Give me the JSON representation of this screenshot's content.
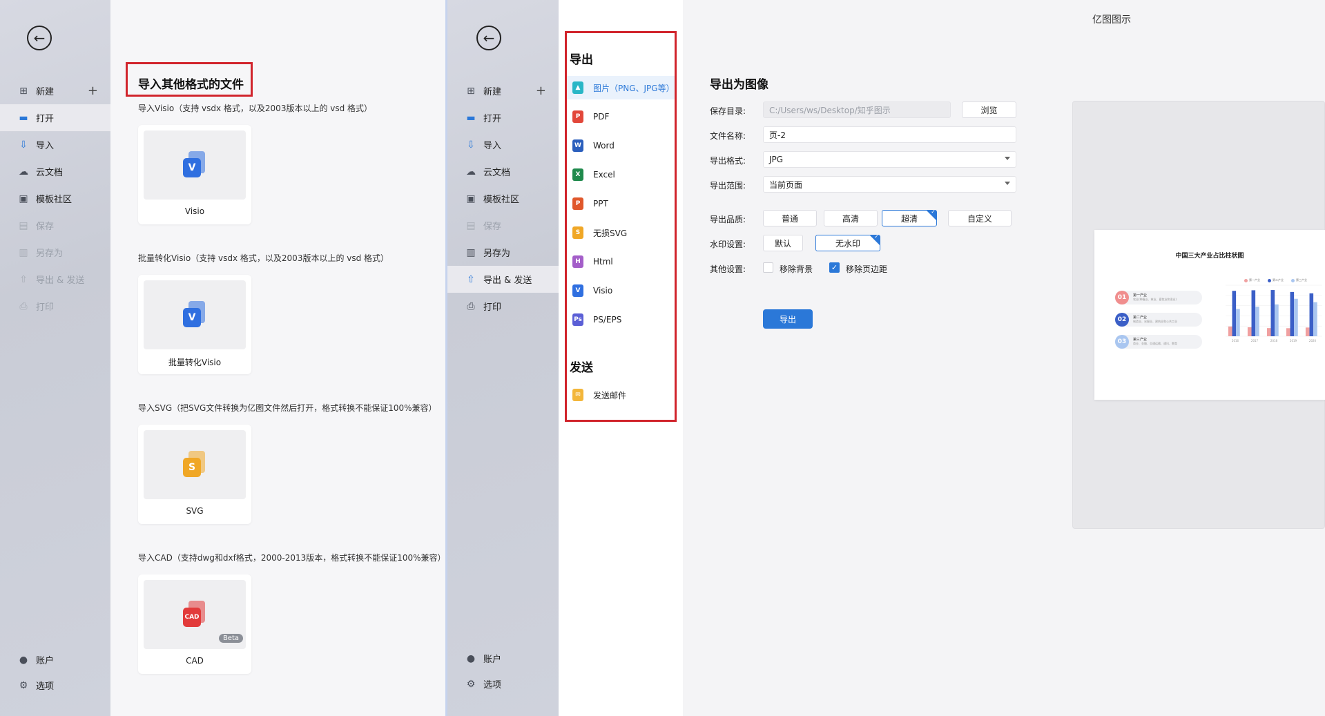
{
  "app_title": "亿图图示",
  "left_nav": {
    "items": [
      {
        "label": "新建",
        "icon": "plus-square-icon",
        "state": "normal"
      },
      {
        "label": "打开",
        "icon": "folder-icon",
        "state": "active"
      },
      {
        "label": "导入",
        "icon": "import-icon",
        "state": "normal"
      },
      {
        "label": "云文档",
        "icon": "cloud-icon",
        "state": "normal"
      },
      {
        "label": "模板社区",
        "icon": "community-icon",
        "state": "normal"
      },
      {
        "label": "保存",
        "icon": "save-icon",
        "state": "disabled"
      },
      {
        "label": "另存为",
        "icon": "save-as-icon",
        "state": "disabled"
      },
      {
        "label": "导出 & 发送",
        "icon": "export-icon",
        "state": "disabled"
      },
      {
        "label": "打印",
        "icon": "print-icon",
        "state": "disabled"
      }
    ],
    "bottom": [
      {
        "label": "账户",
        "icon": "account-icon"
      },
      {
        "label": "选项",
        "icon": "gear-icon"
      }
    ]
  },
  "import_panel": {
    "title": "导入其他格式的文件",
    "sections": [
      {
        "desc": "导入Visio（支持 vsdx 格式，以及2003版本以上的 vsd 格式）",
        "card_label": "Visio",
        "icon_letter": "V",
        "color": "#2f6fe0"
      },
      {
        "desc": "批量转化Visio（支持 vsdx 格式，以及2003版本以上的 vsd 格式）",
        "card_label": "批量转化Visio",
        "icon_letter": "V",
        "color": "#2f6fe0"
      },
      {
        "desc": "导入SVG（把SVG文件转换为亿图文件然后打开，格式转换不能保证100%兼容）",
        "card_label": "SVG",
        "icon_letter": "S",
        "color": "#f0a726"
      },
      {
        "desc": "导入CAD（支持dwg和dxf格式，2000-2013版本，格式转换不能保证100%兼容）",
        "card_label": "CAD",
        "icon_letter": "CAD",
        "color": "#e23b3b",
        "badge": "Beta"
      }
    ]
  },
  "right_nav": {
    "items": [
      {
        "label": "新建",
        "icon": "plus-square-icon",
        "state": "normal"
      },
      {
        "label": "打开",
        "icon": "folder-icon",
        "state": "normal"
      },
      {
        "label": "导入",
        "icon": "import-icon",
        "state": "normal"
      },
      {
        "label": "云文档",
        "icon": "cloud-icon",
        "state": "normal"
      },
      {
        "label": "模板社区",
        "icon": "community-icon",
        "state": "normal"
      },
      {
        "label": "保存",
        "icon": "save-icon",
        "state": "disabled"
      },
      {
        "label": "另存为",
        "icon": "save-as-icon",
        "state": "normal"
      },
      {
        "label": "导出 & 发送",
        "icon": "export-icon",
        "state": "active"
      },
      {
        "label": "打印",
        "icon": "print-icon",
        "state": "normal"
      }
    ],
    "bottom": [
      {
        "label": "账户",
        "icon": "account-icon"
      },
      {
        "label": "选项",
        "icon": "gear-icon"
      }
    ]
  },
  "export_menu": {
    "export_heading": "导出",
    "send_heading": "发送",
    "items": [
      {
        "label": "图片（PNG、JPG等）",
        "color": "#29b6c6",
        "letter": "▲",
        "active": true
      },
      {
        "label": "PDF",
        "color": "#e2473a",
        "letter": "P",
        "active": false
      },
      {
        "label": "Word",
        "color": "#2b5fbd",
        "letter": "W",
        "active": false
      },
      {
        "label": "Excel",
        "color": "#1f8a4c",
        "letter": "X",
        "active": false
      },
      {
        "label": "PPT",
        "color": "#e0572b",
        "letter": "P",
        "active": false
      },
      {
        "label": "无损SVG",
        "color": "#f0a726",
        "letter": "S",
        "active": false
      },
      {
        "label": "Html",
        "color": "#a45ec9",
        "letter": "H",
        "active": false
      },
      {
        "label": "Visio",
        "color": "#2f6fe0",
        "letter": "V",
        "active": false
      },
      {
        "label": "PS/EPS",
        "color": "#5b5fd6",
        "letter": "Ps",
        "active": false
      }
    ],
    "send_items": [
      {
        "label": "发送邮件",
        "color": "#f3b63a",
        "letter": "✉"
      }
    ]
  },
  "export_form": {
    "title": "导出为图像",
    "save_dir_label": "保存目录:",
    "save_dir_value": "C:/Users/ws/Desktop/知乎图示",
    "browse_label": "浏览",
    "filename_label": "文件名称:",
    "filename_value": "页-2",
    "format_label": "导出格式:",
    "format_value": "JPG",
    "range_label": "导出范围:",
    "range_value": "当前页面",
    "quality_label": "导出品质:",
    "quality_options": [
      "普通",
      "高清",
      "超清",
      "自定义"
    ],
    "quality_selected": "超清",
    "watermark_label": "水印设置:",
    "watermark_options": [
      "默认",
      "无水印"
    ],
    "watermark_selected": "无水印",
    "other_label": "其他设置:",
    "remove_bg_label": "移除背景",
    "remove_bg_checked": false,
    "remove_margin_label": "移除页边距",
    "remove_margin_checked": true,
    "export_button": "导出"
  },
  "preview": {
    "title": "中国三大产业占比柱状图",
    "rows": [
      {
        "num": "01",
        "name": "第一产业",
        "text": "农业(种植业、林业、畜牧业和渔业)",
        "color": "#f08e8e"
      },
      {
        "num": "02",
        "name": "第二产业",
        "text": "制造业、采掘业、建筑业和公共工业",
        "color": "#3b5fc7"
      },
      {
        "num": "03",
        "name": "第三产业",
        "text": "商业、金融、交通运输、通讯、教育",
        "color": "#a9c6f0"
      }
    ],
    "legend": [
      "第一产业",
      "第二产业",
      "第三产业"
    ],
    "chart_data": {
      "type": "bar",
      "categories": [
        "2016",
        "2017",
        "2018",
        "2019",
        "2020"
      ],
      "series": [
        {
          "name": "第一产业",
          "values": [
            8.6,
            7.9,
            7.2,
            7.1,
            7.7
          ],
          "color": "#f0a0a0"
        },
        {
          "name": "第二产业",
          "values": [
            40,
            40.5,
            40.7,
            39,
            37.8
          ],
          "color": "#3b5fc7"
        },
        {
          "name": "第三产业",
          "values": [
            24,
            26,
            28,
            33,
            30
          ],
          "color": "#a9c6f0"
        }
      ],
      "ylim": [
        0,
        45
      ]
    }
  }
}
